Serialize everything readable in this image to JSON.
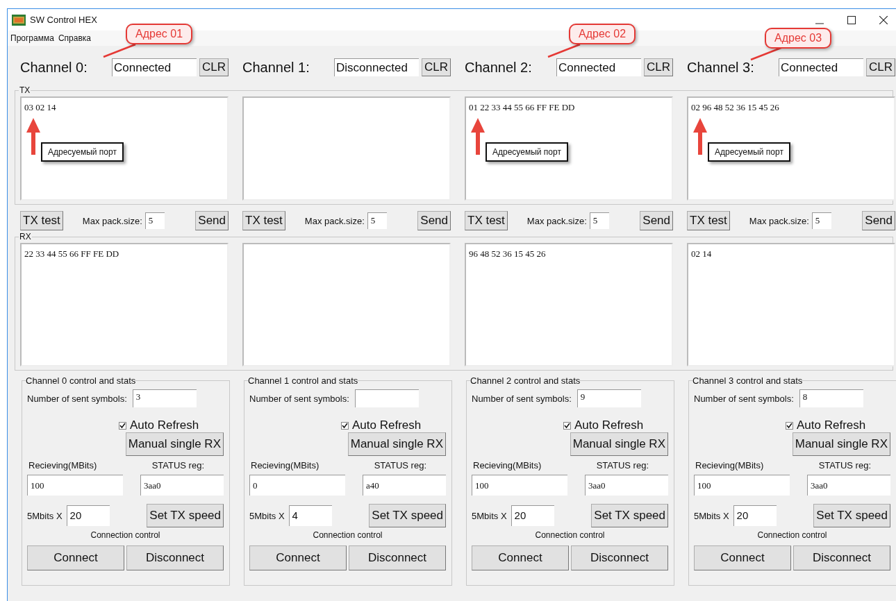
{
  "window": {
    "title": "SW Control HEX"
  },
  "menu": [
    "Программа",
    "Справка"
  ],
  "groups": {
    "tx": "TX",
    "rx": "RX"
  },
  "channels": [
    {
      "label": "Channel 0:",
      "status": "Connected",
      "clr": "CLR",
      "callout": "Адрес 01",
      "tx": {
        "text": "03 02 14",
        "note": "Адресуемый порт"
      },
      "tx_test": "TX test",
      "max_label": "Max pack.size:",
      "max_value": "5",
      "send": "Send",
      "rx": "22 33 44 55 66 FF FE DD",
      "stats": {
        "title": "Channel 0 control and stats",
        "sent_label": "Number of sent symbols:",
        "sent_value": "3",
        "auto_refresh": {
          "label": "Auto Refresh",
          "checked": true
        },
        "manual": "Manual single RX",
        "recv_label": "Recieving(MBits)",
        "status_label": "STATUS reg:",
        "recv_value": "100",
        "status_value": "3aa0",
        "speed_label": "5Mbits X",
        "speed_value": "20",
        "set_speed": "Set TX speed",
        "conn_label": "Connection control",
        "connect": "Connect",
        "disconnect": "Disconnect"
      }
    },
    {
      "label": "Channel 1:",
      "status": "Disconnected",
      "clr": "CLR",
      "tx_test": "TX test",
      "max_label": "Max pack.size:",
      "max_value": "5",
      "send": "Send",
      "stats": {
        "title": "Channel 1 control and stats",
        "sent_label": "Number of sent symbols:",
        "auto_refresh": {
          "label": "Auto Refresh",
          "checked": true
        },
        "manual": "Manual single RX",
        "recv_label": "Recieving(MBits)",
        "status_label": "STATUS reg:",
        "recv_value": "0",
        "status_value": "a40",
        "speed_label": "5Mbits X",
        "speed_value": "4",
        "set_speed": "Set TX speed",
        "conn_label": "Connection control",
        "connect": "Connect",
        "disconnect": "Disconnect"
      }
    },
    {
      "label": "Channel 2:",
      "status": "Connected",
      "clr": "CLR",
      "callout": "Адрес 02",
      "tx": {
        "text": "01 22 33 44 55 66 FF FE DD",
        "note": "Адресуемый порт"
      },
      "tx_test": "TX test",
      "max_label": "Max pack.size:",
      "max_value": "5",
      "send": "Send",
      "rx": "96 48 52 36 15 45 26",
      "stats": {
        "title": "Channel 2 control and stats",
        "sent_label": "Number of sent symbols:",
        "sent_value": "9",
        "auto_refresh": {
          "label": "Auto Refresh",
          "checked": true
        },
        "manual": "Manual single RX",
        "recv_label": "Recieving(MBits)",
        "status_label": "STATUS reg:",
        "recv_value": "100",
        "status_value": "3aa0",
        "speed_label": "5Mbits X",
        "speed_value": "20",
        "set_speed": "Set TX speed",
        "conn_label": "Connection control",
        "connect": "Connect",
        "disconnect": "Disconnect"
      }
    },
    {
      "label": "Channel 3:",
      "status": "Connected",
      "clr": "CLR",
      "callout": "Адрес 03",
      "tx": {
        "text": "02 96 48 52 36 15 45 26",
        "note": "Адресуемый порт"
      },
      "tx_test": "TX test",
      "max_label": "Max pack.size:",
      "max_value": "5",
      "send": "Send",
      "rx": "02 14",
      "stats": {
        "title": "Channel 3 control and stats",
        "sent_label": "Number of sent symbols:",
        "sent_value": "8",
        "auto_refresh": {
          "label": "Auto Refresh",
          "checked": true
        },
        "manual": "Manual single RX",
        "recv_label": "Recieving(MBits)",
        "status_label": "STATUS reg:",
        "recv_value": "100",
        "status_value": "3aa0",
        "speed_label": "5Mbits X",
        "speed_value": "20",
        "set_speed": "Set TX speed",
        "conn_label": "Connection control",
        "connect": "Connect",
        "disconnect": "Disconnect"
      }
    }
  ]
}
